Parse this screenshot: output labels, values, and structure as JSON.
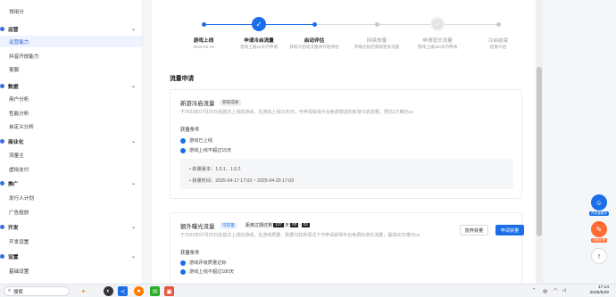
{
  "sidebar": {
    "items": [
      {
        "label": "领用分",
        "type": "item"
      },
      {
        "label": "运营",
        "type": "section"
      },
      {
        "label": "运营能力",
        "type": "item",
        "active": true
      },
      {
        "label": "抖音开放能力",
        "type": "item"
      },
      {
        "label": "客服",
        "type": "item"
      },
      {
        "label": "数据",
        "type": "section"
      },
      {
        "label": "用户分析",
        "type": "item"
      },
      {
        "label": "性能分析",
        "type": "item"
      },
      {
        "label": "自定义分析",
        "type": "item"
      },
      {
        "label": "商业化",
        "type": "section"
      },
      {
        "label": "流量主",
        "type": "item"
      },
      {
        "label": "虚拟支付",
        "type": "item"
      },
      {
        "label": "推广",
        "type": "section"
      },
      {
        "label": "发行人计划",
        "type": "item"
      },
      {
        "label": "广告投放",
        "type": "item"
      },
      {
        "label": "开发",
        "type": "section"
      },
      {
        "label": "开发设置",
        "type": "item"
      },
      {
        "label": "设置",
        "type": "section"
      },
      {
        "label": "基础设置",
        "type": "item"
      }
    ]
  },
  "steps": [
    {
      "label": "游戏上线",
      "sub": "2023-04-16",
      "state": "done"
    },
    {
      "label": "申请冷启流量",
      "sub": "游戏上线15天内申请",
      "state": "current"
    },
    {
      "label": "启动评估",
      "sub": "获取冷启动流量并开始评估",
      "state": "done"
    },
    {
      "label": "持续放量",
      "sub": "评级达标后获取更多流量",
      "state": "pending"
    },
    {
      "label": "申请增长流量",
      "sub": "游戏上线180天内申请",
      "state": "pending"
    },
    {
      "label": "冷启结束",
      "sub": "结束冷启",
      "state": "pending"
    }
  ],
  "section_title": "流量申请",
  "card1": {
    "title": "新游冷启流量",
    "tag": "获取成果",
    "desc": "于2023年07月25日后首次上线的游戏，在游戏上线15天内，可申请获得平台免费赠送的新游冷启流量；预估1万曝光uv",
    "cond_title": "获量条件",
    "conditions": [
      "游戏已上线",
      "游戏上线不超过15天"
    ],
    "info": [
      "获量版本：1.0.1、1.0.2",
      "获量时间：2025-04-17 17:03 ~ 2025-04-20 17:03"
    ]
  },
  "card2": {
    "title": "额外曝光流量",
    "tag": "可获量",
    "timer_label": "距离过期还剩",
    "timer_values": [
      "137",
      "00",
      "01"
    ],
    "timer_sep": "天",
    "desc": "于2023年07月25日后首次上线的游戏，在游戏质量、数据均较高情况下可申请获得平台免费的增长流量；最高60万曝光uv",
    "cond_title": "获量条件",
    "conditions": [
      "游戏评级质量达标",
      "游戏上线不超过180天"
    ],
    "btn_secondary": "放弃获量",
    "btn_primary": "申请获量"
  },
  "float_widgets": [
    {
      "label": "开发者助手",
      "color": "#1a6fe8"
    },
    {
      "label": "体验反馈",
      "color": "#ff6b35"
    }
  ],
  "taskbar": {
    "search_placeholder": "搜索",
    "lang": "中",
    "time": "17:14",
    "date": "2025/5/29"
  }
}
